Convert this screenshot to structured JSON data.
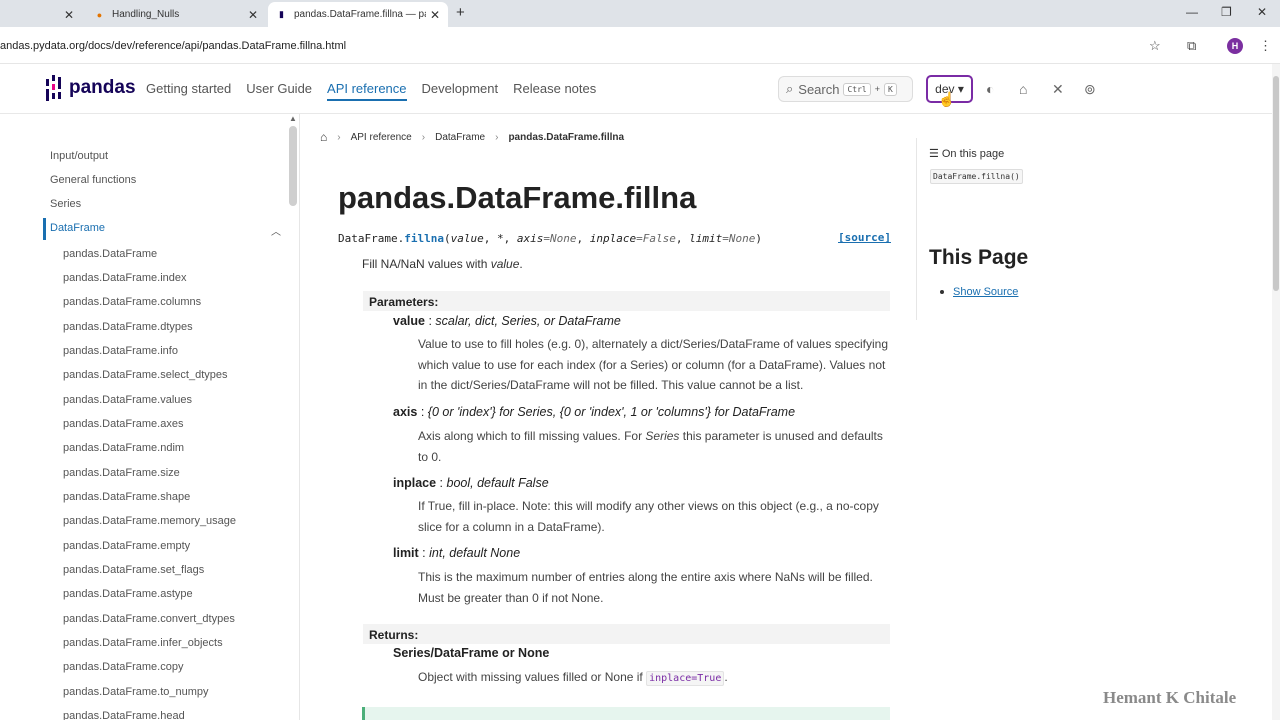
{
  "browser": {
    "tabs": [
      {
        "title": "",
        "close": "✕"
      },
      {
        "title": "Handling_Nulls",
        "close": "✕"
      },
      {
        "title": "pandas.DataFrame.fillna — pandas",
        "close": "✕"
      }
    ],
    "new_tab": "+",
    "url": "andas.pydata.org/docs/dev/reference/api/pandas.DataFrame.fillna.html",
    "avatar": "H",
    "window_controls": {
      "minimize": "—",
      "restore": "❐",
      "close": "✕"
    }
  },
  "header": {
    "logo_text": "pandas",
    "nav": [
      "Getting started",
      "User Guide",
      "API reference",
      "Development",
      "Release notes"
    ],
    "active_nav": "API reference",
    "search_label": "Search",
    "search_keys": [
      "Ctrl",
      "+",
      "K"
    ],
    "version": "dev ▾"
  },
  "sidebar": {
    "top_items": [
      "Input/output",
      "General functions",
      "Series",
      "DataFrame"
    ],
    "active": "DataFrame",
    "sub_items": [
      "pandas.DataFrame",
      "pandas.DataFrame.index",
      "pandas.DataFrame.columns",
      "pandas.DataFrame.dtypes",
      "pandas.DataFrame.info",
      "pandas.DataFrame.select_dtypes",
      "pandas.DataFrame.values",
      "pandas.DataFrame.axes",
      "pandas.DataFrame.ndim",
      "pandas.DataFrame.size",
      "pandas.DataFrame.shape",
      "pandas.DataFrame.memory_usage",
      "pandas.DataFrame.empty",
      "pandas.DataFrame.set_flags",
      "pandas.DataFrame.astype",
      "pandas.DataFrame.convert_dtypes",
      "pandas.DataFrame.infer_objects",
      "pandas.DataFrame.copy",
      "pandas.DataFrame.to_numpy",
      "pandas.DataFrame.head"
    ]
  },
  "breadcrumb": {
    "items": [
      "API reference",
      "DataFrame",
      "pandas.DataFrame.fillna"
    ]
  },
  "main": {
    "title": "pandas.DataFrame.fillna",
    "signature": {
      "prefix": "DataFrame.",
      "fn": "fillna",
      "open": "(",
      "p1": "value",
      "p2": ", *, ",
      "p3": "axis",
      "d3": "=None",
      "p4": "inplace",
      "d4": "=False",
      "p5": "limit",
      "d5": "=None",
      "close": ")"
    },
    "source_link": "[source]",
    "summary_a": "Fill NA/NaN values with ",
    "summary_b": "value",
    "summary_c": ".",
    "parameters_label": "Parameters:",
    "params": [
      {
        "name": "value",
        "type": "scalar, dict, Series, or DataFrame",
        "desc": "Value to use to fill holes (e.g. 0), alternately a dict/Series/DataFrame of values specifying which value to use for each index (for a Series) or column (for a DataFrame). Values not in the dict/Series/DataFrame will not be filled. This value cannot be a list."
      },
      {
        "name": "axis",
        "type": "{0 or 'index'} for Series, {0 or 'index', 1 or 'columns'} for DataFrame",
        "desc_a": "Axis along which to fill missing values. For ",
        "desc_b": "Series",
        "desc_c": " this parameter is unused and defaults to 0."
      },
      {
        "name": "inplace",
        "type": "bool, default False",
        "desc": "If True, fill in-place. Note: this will modify any other views on this object (e.g., a no-copy slice for a column in a DataFrame)."
      },
      {
        "name": "limit",
        "type": "int, default None",
        "desc": "This is the maximum number of entries along the entire axis where NaNs will be filled. Must be greater than 0 if not None."
      }
    ],
    "returns_label": "Returns:",
    "returns_type": "Series/DataFrame or None",
    "returns_desc_a": "Object with missing values filled or None if ",
    "returns_code": "inplace=True",
    "returns_desc_c": "."
  },
  "toc": {
    "title": "On this page",
    "items": [
      "DataFrame.fillna()"
    ],
    "this_page": "This Page",
    "show_source": "Show Source"
  },
  "watermark": "Hemant K Chitale",
  "colors": {
    "accent": "#1a6fb0",
    "brand": "#150458",
    "version_border": "#7a2ba5"
  }
}
